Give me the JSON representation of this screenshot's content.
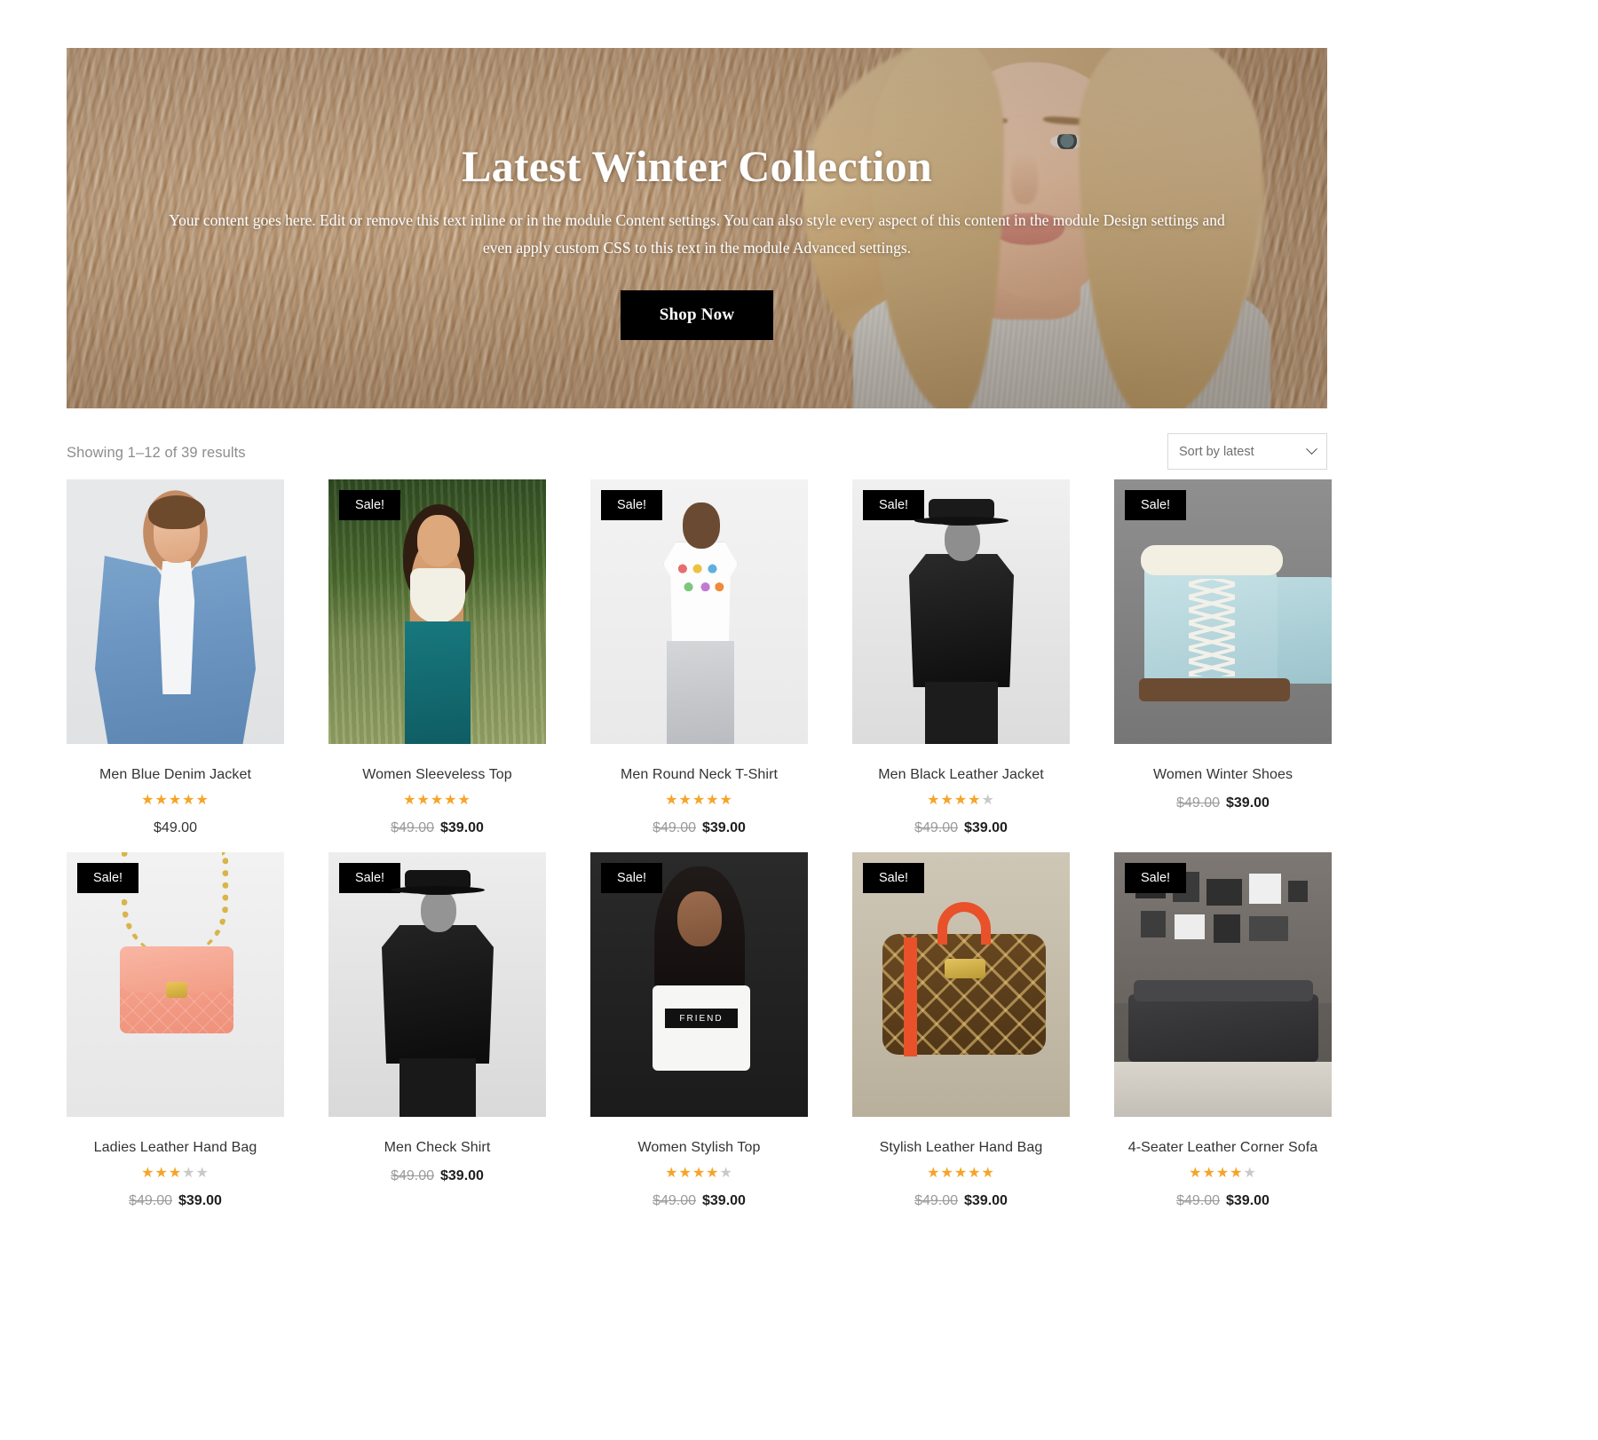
{
  "hero": {
    "title": "Latest Winter Collection",
    "paragraph": "Your content goes here. Edit or remove this text inline or in the module Content settings. You can also style every aspect of this content in the module Design settings and even apply custom CSS to this text in the module Advanced settings.",
    "cta_label": "Shop Now"
  },
  "toolbar": {
    "result_count": "Showing 1–12 of 39 results",
    "sort_selected": "Sort by latest",
    "sort_options": [
      "Sort by latest"
    ]
  },
  "labels": {
    "sale_badge": "Sale!"
  },
  "colors": {
    "star_filled": "#f6a429",
    "star_empty": "#c9c9c9",
    "badge_bg": "#000000",
    "badge_text": "#ffffff",
    "price_old": "#9b9b9b",
    "price_new": "#1f1f1f"
  },
  "products": [
    {
      "title": "Men Blue Denim Jacket",
      "on_sale": false,
      "rating": 5,
      "has_rating": true,
      "price_old": "",
      "price_new": "$49.00",
      "thumb": "man-in-blue-denim-jacket"
    },
    {
      "title": "Women Sleeveless Top",
      "on_sale": true,
      "rating": 5,
      "has_rating": true,
      "price_old": "$49.00",
      "price_new": "$39.00",
      "thumb": "woman-in-white-crop-top-outdoors"
    },
    {
      "title": "Men Round Neck T-Shirt",
      "on_sale": true,
      "rating": 5,
      "has_rating": true,
      "price_old": "$49.00",
      "price_new": "$39.00",
      "thumb": "man-in-white-printed-tshirt"
    },
    {
      "title": "Men Black Leather Jacket",
      "on_sale": true,
      "rating": 4,
      "has_rating": true,
      "price_old": "$49.00",
      "price_new": "$39.00",
      "thumb": "man-in-black-leather-jacket-and-hat"
    },
    {
      "title": "Women Winter Shoes",
      "on_sale": true,
      "rating": 0,
      "has_rating": false,
      "price_old": "$49.00",
      "price_new": "$39.00",
      "thumb": "pale-blue-winter-boots"
    },
    {
      "title": "Ladies Leather Hand Bag",
      "on_sale": true,
      "rating": 3,
      "has_rating": true,
      "price_old": "$49.00",
      "price_new": "$39.00",
      "thumb": "pink-quilted-chain-handbag"
    },
    {
      "title": "Men Check Shirt",
      "on_sale": true,
      "rating": 0,
      "has_rating": false,
      "price_old": "$49.00",
      "price_new": "$39.00",
      "thumb": "man-in-black-jacket-and-hat"
    },
    {
      "title": "Women Stylish Top",
      "on_sale": true,
      "rating": 4,
      "has_rating": true,
      "price_old": "$49.00",
      "price_new": "$39.00",
      "thumb": "woman-in-white-friend-crop-top"
    },
    {
      "title": "Stylish Leather Hand Bag",
      "on_sale": true,
      "rating": 5,
      "has_rating": true,
      "price_old": "$49.00",
      "price_new": "$39.00",
      "thumb": "monogram-bag-with-red-handles"
    },
    {
      "title": "4-Seater Leather Corner Sofa",
      "on_sale": true,
      "rating": 4,
      "has_rating": true,
      "price_old": "$49.00",
      "price_new": "$39.00",
      "thumb": "dark-grey-sofa-in-living-room"
    }
  ]
}
